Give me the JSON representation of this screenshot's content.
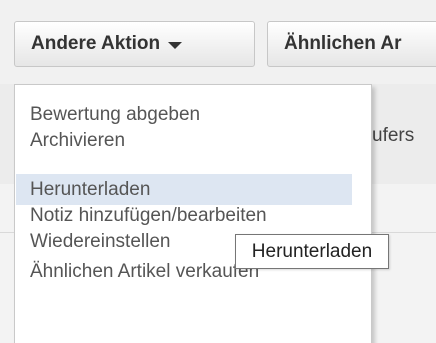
{
  "toolbar": {
    "other_action_label": "Andere Aktion",
    "similar_label": "Ähnlichen Ar"
  },
  "background": {
    "column_text": "ufers"
  },
  "menu": {
    "items": [
      {
        "label": "Bewertung abgeben"
      },
      {
        "label": "Archivieren"
      },
      {
        "label": "Herunterladen"
      },
      {
        "label": "Notiz hinzufügen/bearbeiten"
      },
      {
        "label": "Wiedereinstellen"
      },
      {
        "label": "Ähnlichen Artikel verkaufen"
      }
    ],
    "highlighted_index": 2
  },
  "tooltip": {
    "text": "Herunterladen"
  },
  "colors": {
    "highlight": "#dde6f2",
    "menu_text": "#555555"
  }
}
